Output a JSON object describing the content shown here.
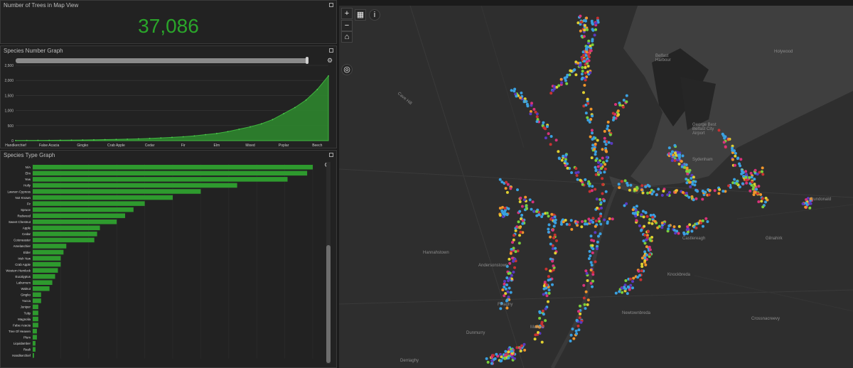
{
  "count_panel": {
    "title": "Number of Trees in Map View",
    "value": "37,086"
  },
  "species_number_panel": {
    "title": "Species Number Graph",
    "chart_data": {
      "type": "area",
      "color": "#2e8b2e",
      "x": [
        "Handkerchief",
        "",
        "",
        "False Acacia",
        "",
        "",
        "Gingko",
        "",
        "",
        "Crab Apple",
        "",
        "",
        "Cedar",
        "",
        "",
        "Fir",
        "",
        "",
        "Elm",
        "",
        "",
        "Mixed",
        "",
        "",
        "Poplar",
        "",
        "",
        "Beech",
        ""
      ],
      "x_tick_labels": [
        "Handkerchief",
        "False Acacia",
        "Gingko",
        "Crab Apple",
        "Cedar",
        "Fir",
        "Elm",
        "Mixed",
        "Poplar",
        "Beech"
      ],
      "values": [
        5,
        8,
        10,
        12,
        15,
        18,
        22,
        28,
        35,
        42,
        50,
        60,
        75,
        90,
        110,
        130,
        160,
        200,
        240,
        300,
        380,
        460,
        560,
        700,
        900,
        1100,
        1350,
        1700,
        2150
      ],
      "ylim": [
        0,
        2500
      ],
      "yticks": [
        0,
        500,
        1000,
        1500,
        2000,
        2500
      ],
      "ytick_labels": [
        "0",
        "500",
        "1,000",
        "1,500",
        "2,000",
        "2,500"
      ],
      "grid": true
    }
  },
  "species_type_panel": {
    "title": "Species Type Graph",
    "chart_data": {
      "type": "bar",
      "orientation": "horizontal",
      "color": "#2e9a2e",
      "categories": [
        "N/A",
        "Elm",
        "Yew",
        "Holly",
        "Lawson Cypress",
        "Not Known",
        "Fir",
        "Spruce",
        "Redwood",
        "Sweet Chestnut",
        "Apple",
        "Cedar",
        "Cotoneaster",
        "Amelanchier",
        "Elder",
        "Irish Yew",
        "Crab Apple",
        "Western Hemlock",
        "Eucalyptus",
        "Laburnum",
        "Walnut",
        "Gingko",
        "Yucca",
        "Juniper",
        "Tulip",
        "Magnolia",
        "False Acacia",
        "Tree Of Heaven",
        "Plum",
        "Liquidamber",
        "Rauli",
        "Handkerchief"
      ],
      "values": [
        100,
        98,
        91,
        73,
        60,
        50,
        40,
        36,
        33,
        30,
        24,
        23,
        22,
        12,
        11,
        10,
        10,
        9,
        8,
        7,
        6,
        3,
        3,
        2,
        2,
        2,
        2,
        1.5,
        1.5,
        1,
        1,
        0.5
      ],
      "xlim": [
        0,
        100
      ],
      "grid": true
    }
  },
  "map": {
    "controls": {
      "zoom_in": "+",
      "zoom_out": "−",
      "home": "⌂",
      "basemap": "▦",
      "info": "i",
      "locate": "◎"
    },
    "places": [
      {
        "label": "Belfast Harbour"
      },
      {
        "label": "Holywood"
      },
      {
        "label": "George Best Belfast City Airport"
      },
      {
        "label": "Sydenham"
      },
      {
        "label": "Dundonald"
      },
      {
        "label": "Gilnahirk"
      },
      {
        "label": "Castlereagh"
      },
      {
        "label": "Knockbreda"
      },
      {
        "label": "Newtownbreda"
      },
      {
        "label": "Crossnacreevy"
      },
      {
        "label": "Hannahstown"
      },
      {
        "label": "Andersonstown"
      },
      {
        "label": "Finaghy"
      },
      {
        "label": "Malone"
      },
      {
        "label": "Dunmurry"
      },
      {
        "label": "Derriaghy"
      },
      {
        "label": "Cave Hill"
      }
    ]
  }
}
